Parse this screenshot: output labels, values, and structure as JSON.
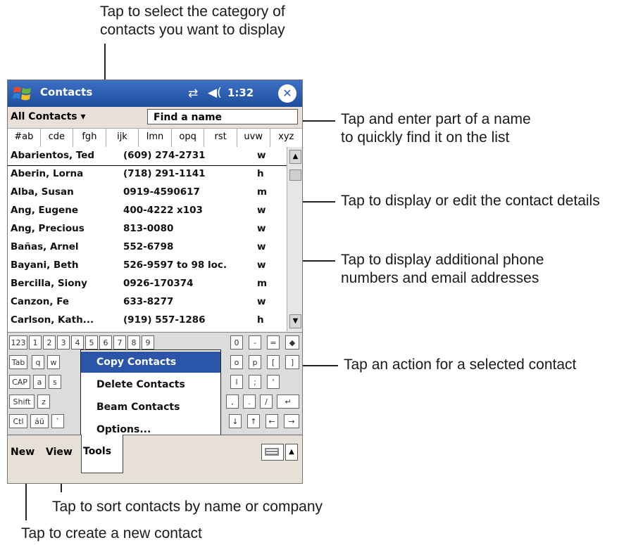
{
  "callouts": {
    "top_line1": "Tap to select the category of",
    "top_line2": "contacts you want to display",
    "find_line1": "Tap and enter part of a name",
    "find_line2": "to quickly find it on the list",
    "details": "Tap to display or edit the contact details",
    "phone_line1": "Tap to display additional phone",
    "phone_line2": "numbers and email addresses",
    "action": "Tap an action for a selected contact",
    "sort": "Tap to sort contacts by name or company",
    "create": "Tap to create a new contact"
  },
  "titlebar": {
    "app_title": "Contacts",
    "clock": "1:32",
    "close_glyph": "✕",
    "sync_glyph": "⇄",
    "volume_glyph": "◀("
  },
  "toolbar": {
    "category": "All Contacts ▾",
    "find_placeholder": "Find a name"
  },
  "abc_tabs": [
    "#ab",
    "cde",
    "fgh",
    "ijk",
    "lmn",
    "opq",
    "rst",
    "uvw",
    "xyz"
  ],
  "contacts": [
    {
      "name": "Abarientos, Ted",
      "phone": "(609) 274-2731",
      "type": "w"
    },
    {
      "name": "Aberin, Lorna",
      "phone": "(718) 291-1141",
      "type": "h"
    },
    {
      "name": "Alba, Susan",
      "phone": "0919-4590617",
      "type": "m"
    },
    {
      "name": "Ang, Eugene",
      "phone": "400-4222 x103",
      "type": "w"
    },
    {
      "name": "Ang, Precious",
      "phone": "813-0080",
      "type": "w"
    },
    {
      "name": "Bañas, Arnel",
      "phone": "552-6798",
      "type": "w"
    },
    {
      "name": "Bayani, Beth",
      "phone": "526-9597 to 98  loc.",
      "type": "w"
    },
    {
      "name": "Bercilla, Siony",
      "phone": "0926-170374",
      "type": "m"
    },
    {
      "name": "Canzon, Fe",
      "phone": "633-8277",
      "type": "w"
    },
    {
      "name": "Carlson, Kath...",
      "phone": "(919) 557-1286",
      "type": "h"
    }
  ],
  "keyboard": {
    "row1": [
      "123",
      "1",
      "2",
      "3",
      "4",
      "5",
      "6",
      "7",
      "8",
      "9",
      "0",
      "-",
      "=",
      "◆"
    ],
    "row2": [
      "Tab",
      "q",
      "w",
      "",
      "",
      "",
      "",
      "",
      "",
      "o",
      "p",
      "[",
      "]"
    ],
    "row3": [
      "CAP",
      "a",
      "s",
      "",
      "",
      "",
      "",
      "",
      "l",
      ";",
      "'"
    ],
    "row4": [
      "Shift",
      "z",
      "",
      "",
      "",
      "",
      "",
      "",
      ",",
      ".",
      "/",
      "↵"
    ],
    "row5": [
      "Ctl",
      "áü",
      "`",
      "",
      "",
      "",
      "",
      "↓",
      "↑",
      "←",
      "→"
    ]
  },
  "menu": {
    "items": [
      "Copy Contacts",
      "Delete Contacts",
      "Beam Contacts",
      "Options..."
    ]
  },
  "cmdbar": {
    "new": "New",
    "view": "View",
    "tools": "Tools",
    "arrow": "▲"
  }
}
